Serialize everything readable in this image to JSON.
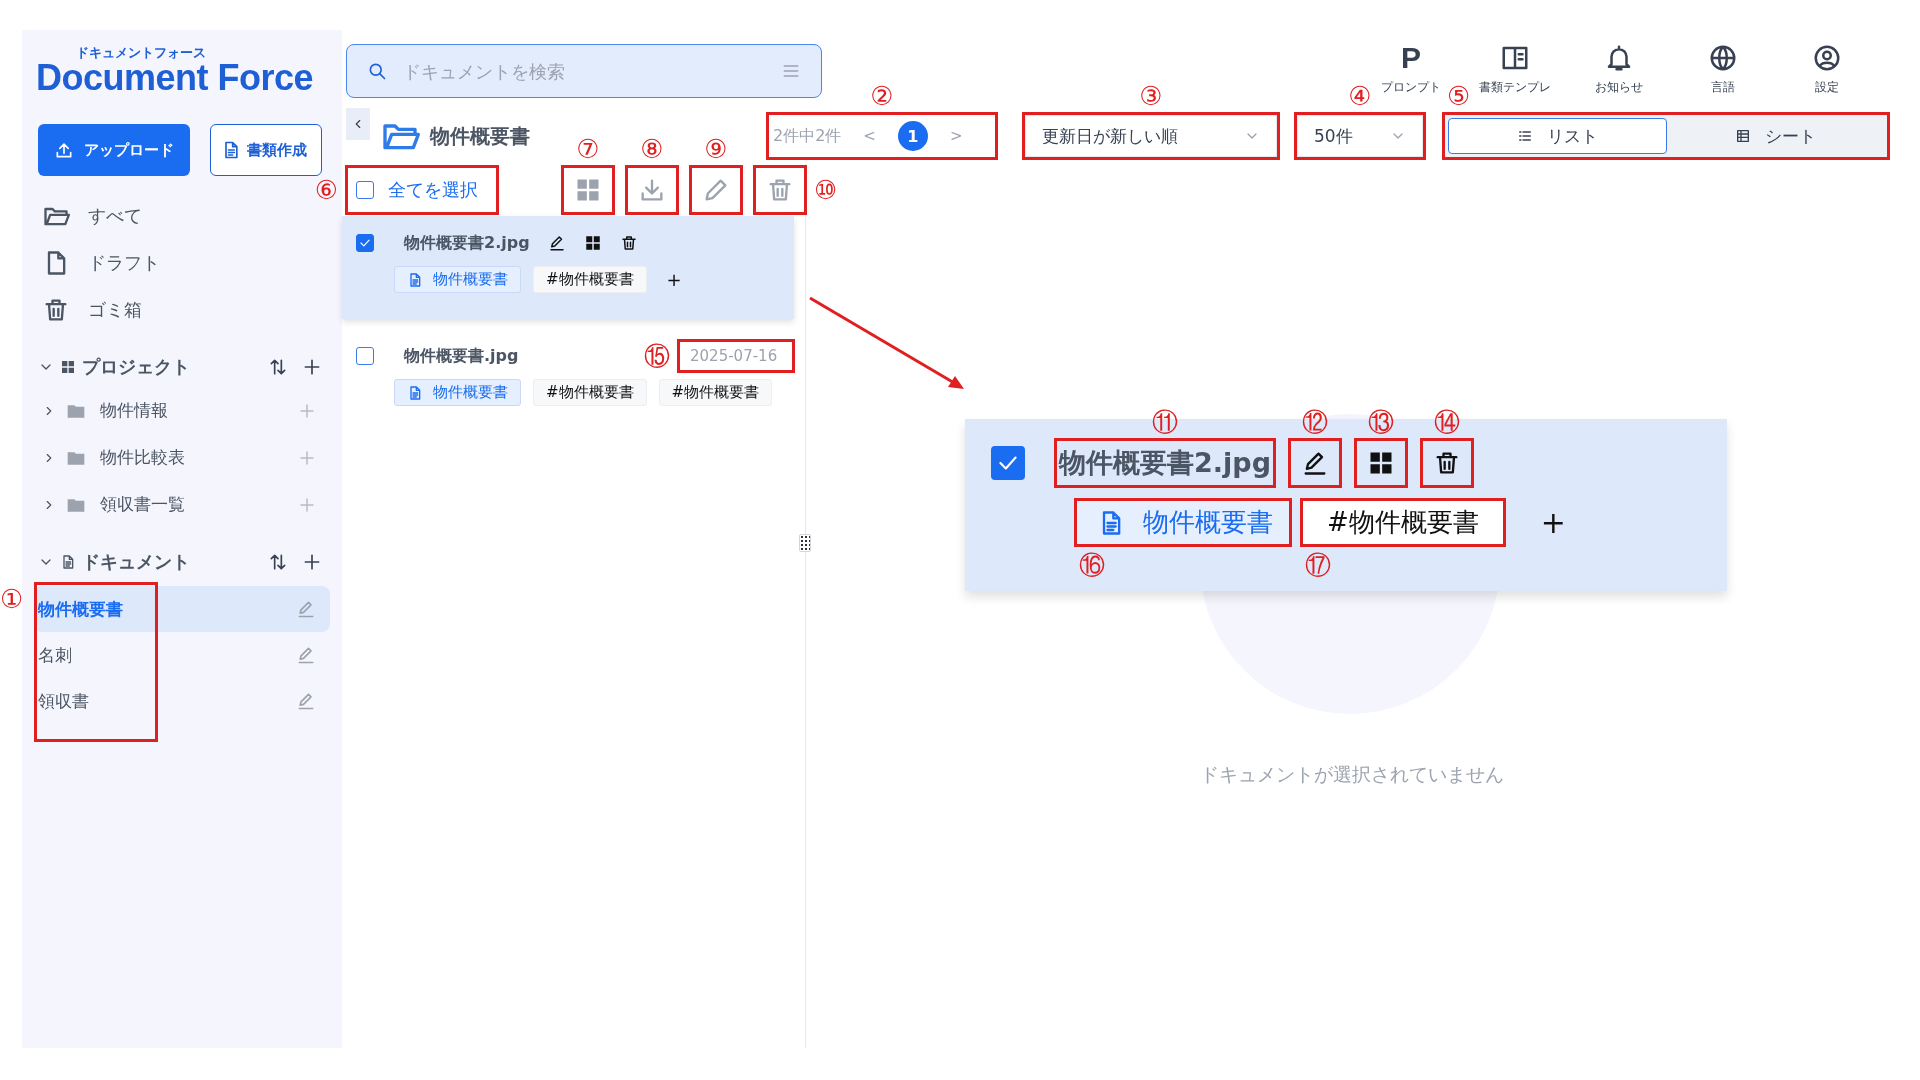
{
  "logo": {
    "caption": "ドキュメントフォース",
    "wordmark": "Document Force"
  },
  "sidebar": {
    "buttons": [
      {
        "kind": "primary",
        "label": "アップロード"
      },
      {
        "kind": "outline",
        "label": "書類作成"
      }
    ],
    "nav": [
      {
        "kind": "folder",
        "label": "すべて"
      },
      {
        "kind": "file",
        "label": "ドラフト"
      },
      {
        "kind": "trash",
        "label": "ゴミ箱"
      }
    ],
    "sections": [
      {
        "kind": "project",
        "title": "プロジェクト",
        "expanded": true,
        "items": [
          {
            "label": "物件情報",
            "expanded": false
          },
          {
            "label": "物件比較表",
            "expanded": false
          },
          {
            "label": "領収書一覧",
            "expanded": false
          }
        ]
      },
      {
        "kind": "document",
        "title": "ドキュメント",
        "expanded": true,
        "callout": "①",
        "items": [
          {
            "label": "物件概要書",
            "selected": true
          },
          {
            "label": "名刺",
            "selected": false
          },
          {
            "label": "領収書",
            "selected": false
          }
        ]
      }
    ]
  },
  "search": {
    "placeholder": "ドキュメントを検索"
  },
  "top_icons": [
    {
      "kind": "prompt",
      "glyph": "P",
      "label": "プロンプト"
    },
    {
      "kind": "template",
      "label": "書類テンプレ"
    },
    {
      "kind": "notice",
      "label": "お知らせ"
    },
    {
      "kind": "language",
      "label": "言語"
    },
    {
      "kind": "account",
      "label": "設定"
    }
  ],
  "folder_title": "物件概要書",
  "pagination": {
    "summary": "2件中2件",
    "prev": "<",
    "next": ">",
    "callout": "②",
    "pages": [
      {
        "label": "1",
        "selected": true
      }
    ]
  },
  "sort": {
    "value": "更新日が新しい順",
    "callout": "③"
  },
  "per_page": {
    "value": "50件",
    "callout": "④"
  },
  "view_toggle": {
    "callout": "⑤",
    "options": [
      {
        "kind": "list",
        "label": "リスト",
        "selected": true
      },
      {
        "kind": "sheet",
        "label": "シート",
        "selected": false
      }
    ]
  },
  "select_all": {
    "label": "全てを選択",
    "checked": false,
    "callout": "⑥"
  },
  "bulk_actions": [
    {
      "kind": "grid",
      "callout": "⑦"
    },
    {
      "kind": "download",
      "callout": "⑧"
    },
    {
      "kind": "edit",
      "callout": "⑨"
    },
    {
      "kind": "trash",
      "callout": "⑩"
    }
  ],
  "documents": [
    {
      "name": "物件概要書2.jpg",
      "checked": true,
      "hovered": true,
      "type_tag": "物件概要書",
      "hashtags": [
        "#物件概要書"
      ],
      "add": "+"
    },
    {
      "name": "物件概要書.jpg",
      "checked": false,
      "hovered": false,
      "date": "2025-07-16",
      "date_callout": "⑮",
      "type_tag": "物件概要書",
      "hashtags": [
        "#物件概要書",
        "#物件概要書"
      ]
    }
  ],
  "zoom_callout": {
    "name": "物件概要書2.jpg",
    "name_callout": "⑪",
    "checked": true,
    "actions": [
      {
        "kind": "edit",
        "callout": "⑫"
      },
      {
        "kind": "grid",
        "callout": "⑬"
      },
      {
        "kind": "trash",
        "callout": "⑭"
      }
    ],
    "type_tag": "物件概要書",
    "type_callout": "⑯",
    "hashtag": "#物件概要書",
    "hashtag_callout": "⑰",
    "add": "+"
  },
  "empty_state": {
    "message": "ドキュメントが選択されていません"
  }
}
